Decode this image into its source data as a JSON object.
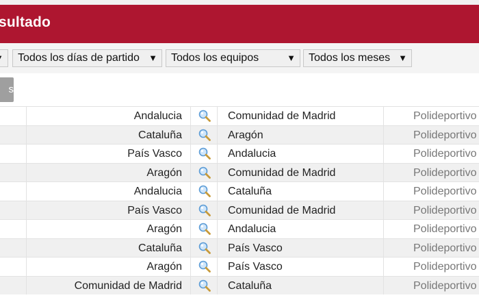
{
  "header": {
    "title": "sultado"
  },
  "filters": [
    {
      "label": "Todos los días de partido"
    },
    {
      "label": "Todos los equipos"
    },
    {
      "label": "Todos los meses"
    }
  ],
  "filter_arrow": "▼",
  "button": {
    "label": "s"
  },
  "rows": [
    {
      "home": "Andalucia",
      "away": "Comunidad de Madrid",
      "venue": "Polideportivo"
    },
    {
      "home": "Cataluña",
      "away": "Aragón",
      "venue": "Polideportivo"
    },
    {
      "home": "País Vasco",
      "away": "Andalucia",
      "venue": "Polideportivo"
    },
    {
      "home": "Aragón",
      "away": "Comunidad de Madrid",
      "venue": "Polideportivo"
    },
    {
      "home": "Andalucia",
      "away": "Cataluña",
      "venue": "Polideportivo"
    },
    {
      "home": "País Vasco",
      "away": "Comunidad de Madrid",
      "venue": "Polideportivo"
    },
    {
      "home": "Aragón",
      "away": "Andalucia",
      "venue": "Polideportivo"
    },
    {
      "home": "Cataluña",
      "away": "País Vasco",
      "venue": "Polideportivo"
    },
    {
      "home": "Aragón",
      "away": "País Vasco",
      "venue": "Polideportivo"
    },
    {
      "home": "Comunidad de Madrid",
      "away": "Cataluña",
      "venue": "Polideportivo"
    }
  ],
  "icons": {
    "detail": "magnifier-icon"
  },
  "colors": {
    "header_bg": "#ae1630",
    "button_bg": "#9f9f9f"
  }
}
